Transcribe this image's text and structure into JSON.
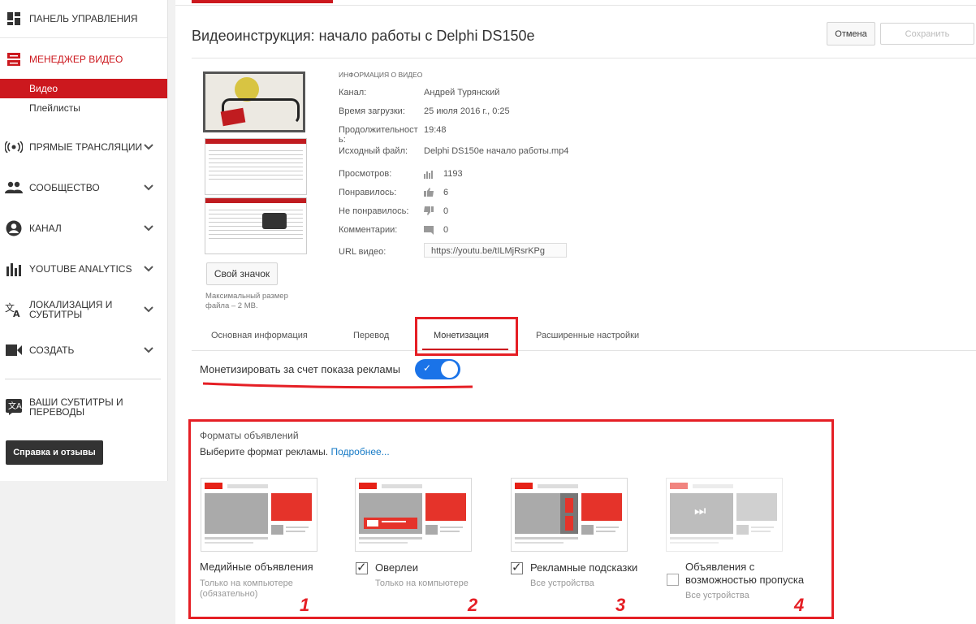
{
  "sidebar": {
    "items": [
      {
        "label": "ПАНЕЛЬ УПРАВЛЕНИЯ",
        "icon": "dashboard-icon"
      },
      {
        "label": "МЕНЕДЖЕР ВИДЕО",
        "icon": "video-manager-icon"
      },
      {
        "label": "ПРЯМЫЕ ТРАНСЛЯЦИИ",
        "icon": "live-icon"
      },
      {
        "label": "СООБЩЕСТВО",
        "icon": "community-icon"
      },
      {
        "label": "КАНАЛ",
        "icon": "channel-icon"
      },
      {
        "label": "YOUTUBE ANALYTICS",
        "icon": "analytics-icon"
      },
      {
        "label": "ЛОКАЛИЗАЦИЯ И СУБТИТРЫ",
        "icon": "translate-icon"
      },
      {
        "label": "СОЗДАТЬ",
        "icon": "create-icon"
      },
      {
        "label": "ВАШИ СУБТИТРЫ И ПЕРЕВОДЫ",
        "icon": "subtitles-icon"
      }
    ],
    "sub_video": "Видео",
    "sub_playlists": "Плейлисты",
    "help_button": "Справка и отзывы"
  },
  "header": {
    "title": "Видеоинструкция: начало работы с Delphi DS150e",
    "cancel": "Отмена",
    "save": "Сохранить"
  },
  "thumb": {
    "custom_button": "Свой значок",
    "hint": "Максимальный размер файла – 2 МВ."
  },
  "info": {
    "heading": "ИНФОРМАЦИЯ О ВИДЕО",
    "channel_label": "Канал:",
    "channel_value": "Андрей Турянский",
    "upload_label": "Время загрузки:",
    "upload_value": "25 июля 2016 г., 0:25",
    "duration_label_1": "Продолжительност",
    "duration_label_2": "ь:",
    "duration_value": "19:48",
    "source_label": "Исходный файл:",
    "source_value": "Delphi DS150e начало работы.mp4",
    "views_label": "Просмотров:",
    "views_value": "1193",
    "likes_label": "Понравилось:",
    "likes_value": "6",
    "dislikes_label": "Не понравилось:",
    "dislikes_value": "0",
    "comments_label": "Комментарии:",
    "comments_value": "0",
    "url_label": "URL видео:",
    "url_value": "https://youtu.be/tILMjRsrKPg"
  },
  "tabs": [
    "Основная информация",
    "Перевод",
    "Монетизация",
    "Расширенные настройки"
  ],
  "monetize": {
    "label": "Монетизировать за счет показа рекламы",
    "enabled": true
  },
  "formats": {
    "title": "Форматы объявлений",
    "choose": "Выберите формат рекламы.",
    "more": "Подробнее...",
    "items": [
      {
        "title": "Медийные объявления",
        "sub": "Только на компьютере (обязательно)",
        "number": "1",
        "checked": null
      },
      {
        "title": "Оверлеи",
        "sub": "Только на компьютере",
        "number": "2",
        "checked": true
      },
      {
        "title": "Рекламные подсказки",
        "sub": "Все устройства",
        "number": "3",
        "checked": true
      },
      {
        "title": "Объявления с возможностью пропуска",
        "sub": "Все устройства",
        "number": "4",
        "checked": false
      }
    ]
  },
  "colors": {
    "accent": "#cc181e",
    "highlight": "#e51f25",
    "toggle": "#1a73e8"
  }
}
